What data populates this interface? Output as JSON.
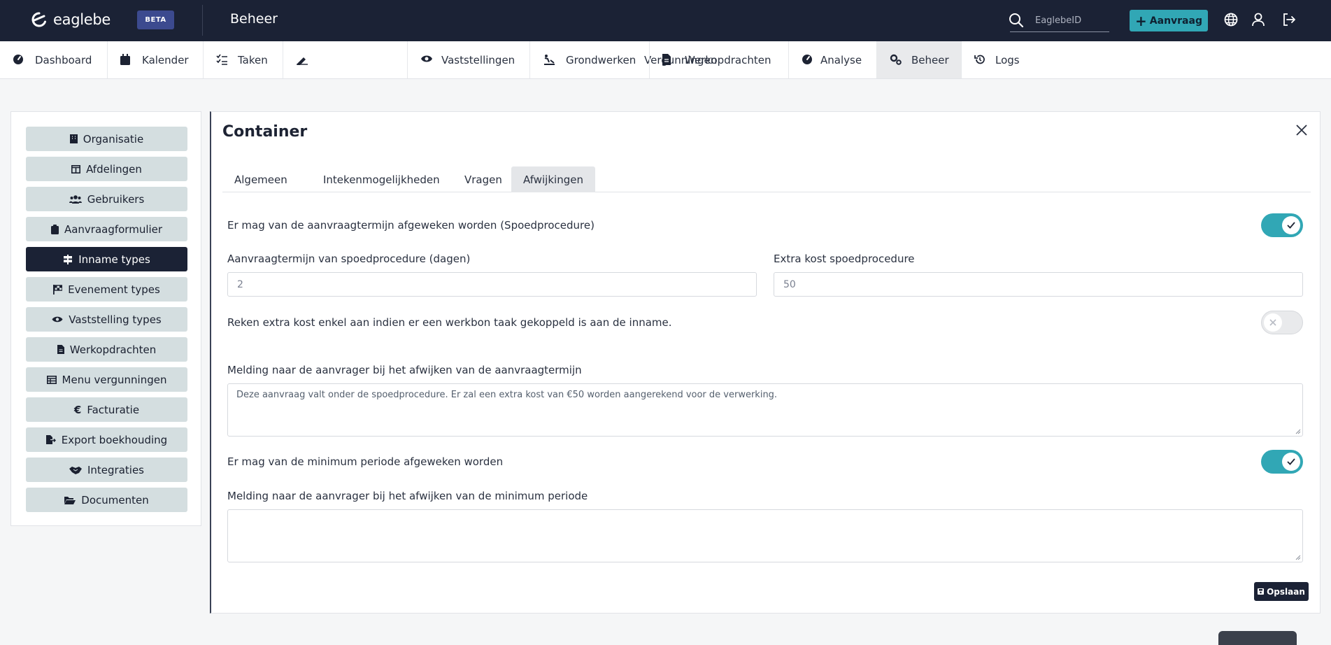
{
  "header": {
    "logo_text": "eaglebe",
    "badge": "BETA",
    "title": "Beheer",
    "search_placeholder": "EaglebeID",
    "new_button": "Aanvraag"
  },
  "nav": [
    {
      "label": "Dashboard",
      "icon": "dashboard-icon"
    },
    {
      "label": "Kalender",
      "icon": "calendar-icon"
    },
    {
      "label": "Taken",
      "icon": "tasks-icon"
    },
    {
      "label": "Vergunningen",
      "icon": "signature-icon"
    },
    {
      "label": "Vaststellingen",
      "icon": "eye-icon"
    },
    {
      "label": "Grondwerken",
      "icon": "digging-icon"
    },
    {
      "label": "Werkopdrachten",
      "icon": "document-icon"
    },
    {
      "label": "Analyse",
      "icon": "gauge-icon"
    },
    {
      "label": "Beheer",
      "icon": "gears-icon",
      "active": true
    },
    {
      "label": "Logs",
      "icon": "history-icon"
    }
  ],
  "sidebar": [
    {
      "label": "Organisatie",
      "icon": "building-icon"
    },
    {
      "label": "Afdelingen",
      "icon": "columns-icon"
    },
    {
      "label": "Gebruikers",
      "icon": "users-icon"
    },
    {
      "label": "Aanvraagformulier",
      "icon": "clipboard-icon"
    },
    {
      "label": "Inname types",
      "icon": "signs-icon",
      "active": true
    },
    {
      "label": "Evenement types",
      "icon": "flag-icon"
    },
    {
      "label": "Vaststelling types",
      "icon": "eye-icon"
    },
    {
      "label": "Werkopdrachten",
      "icon": "document-icon"
    },
    {
      "label": "Menu vergunningen",
      "icon": "table-icon"
    },
    {
      "label": "Facturatie",
      "icon": "euro-icon"
    },
    {
      "label": "Export boekhouding",
      "icon": "file-export-icon"
    },
    {
      "label": "Integraties",
      "icon": "handshake-icon"
    },
    {
      "label": "Documenten",
      "icon": "folder-open-icon"
    }
  ],
  "main": {
    "title": "Container",
    "tabs": [
      "Algemeen",
      "Intekenmogelijkheden",
      "Vragen",
      "Afwijkingen"
    ],
    "active_tab": "Afwijkingen",
    "spoed_label": "Er mag van de aanvraagtermijn afgeweken worden (Spoedprocedure)",
    "spoed_on": true,
    "termijn_label": "Aanvraagtermijn van spoedprocedure (dagen)",
    "termijn_value": "2",
    "kost_label": "Extra kost spoedprocedure",
    "kost_value": "50",
    "werkbon_label": "Reken extra kost enkel aan indien er een werkbon taak gekoppeld is aan de inname.",
    "werkbon_on": false,
    "melding_termijn_label": "Melding naar de aanvrager bij het afwijken van de aanvraagtermijn",
    "melding_termijn_value": "Deze aanvraag valt onder de spoedprocedure. Er zal een extra kost van €50 worden aangerekend voor de verwerking.",
    "periode_label": "Er mag van de minimum periode afgeweken worden",
    "periode_on": true,
    "melding_periode_label": "Melding naar de aanvrager bij het afwijken van de minimum periode",
    "melding_periode_value": "",
    "save_label": "Opslaan"
  },
  "colors": {
    "topbar": "#1b2235",
    "accent": "#31a7b5",
    "sidebar_item": "#d4dee0"
  }
}
